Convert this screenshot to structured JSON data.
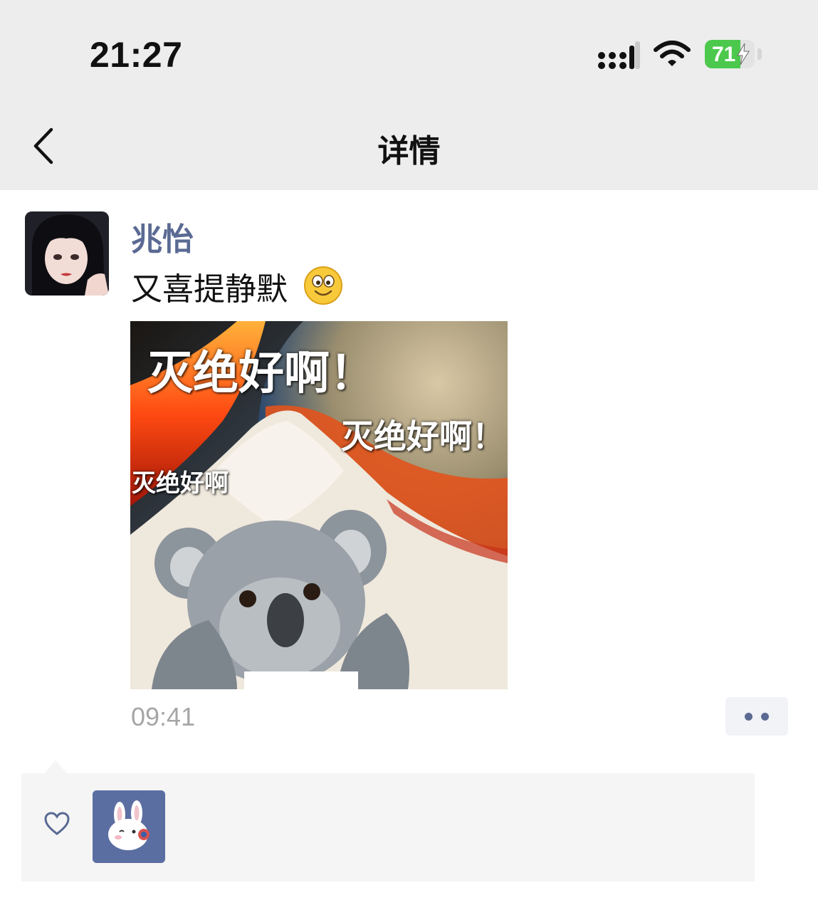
{
  "status_bar": {
    "time": "21:27",
    "battery_level": "71",
    "battery_color": "#4cc84d",
    "signal_icon": "cellular-signal-icon",
    "wifi_icon": "wifi-icon",
    "charging_icon": "lightning-bolt-icon"
  },
  "nav": {
    "title": "详情",
    "back_icon": "chevron-left-icon"
  },
  "post": {
    "author": "兆怡",
    "author_color": "#5a6a93",
    "text": "又喜提静默",
    "emoji_icon": "smiling-face-icon",
    "image": {
      "captions": [
        "灭绝好啊！",
        "灭绝好啊！",
        "灭绝好啊"
      ]
    },
    "timestamp": "09:41",
    "more_icon": "two-dots-icon"
  },
  "likes": {
    "heart_icon": "heart-outline-icon",
    "liker_icon": "rabbit-avatar-icon"
  }
}
